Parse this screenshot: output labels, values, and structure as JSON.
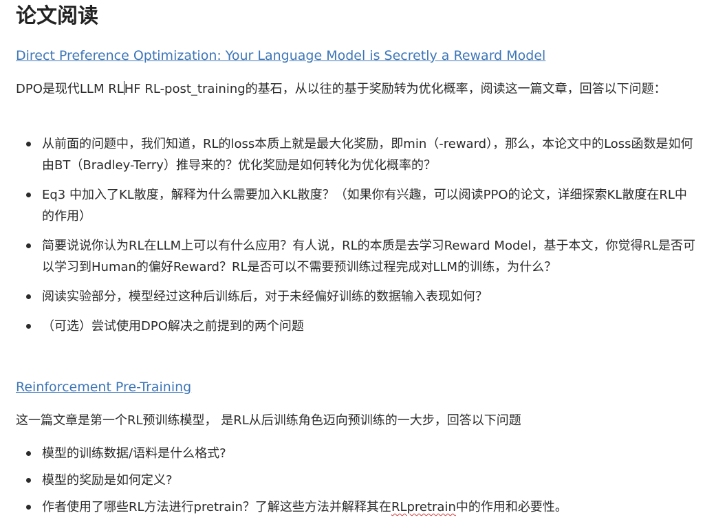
{
  "title": "论文阅读",
  "section1": {
    "link_text": "Direct Preference Optimization: Your Language Model is Secretly a Reward Model",
    "intro_part1": "DPO是现代LLM RL",
    "intro_part2": "HF RL-post_training的基石，从以往的基于奖励转为优化概率，阅读这一篇文章，回答以下问题：",
    "questions": [
      "从前面的问题中，我们知道，RL的loss本质上就是最大化奖励，即min（-reward），那么，本论文中的Loss函数是如何由BT（Bradley-Terry）推导来的？优化奖励是如何转化为优化概率的？",
      "Eq3 中加入了KL散度，解释为什么需要加入KL散度？（如果你有兴趣，可以阅读PPO的论文，详细探索KL散度在RL中的作用）",
      "简要说说你认为RL在LLM上可以有什么应用？有人说，RL的本质是去学习Reward Model，基于本文，你觉得RL是否可以学习到Human的偏好Reward？RL是否可以不需要预训练过程完成对LLM的训练，为什么？",
      "阅读实验部分，模型经过这种后训练后，对于未经偏好训练的数据输入表现如何？",
      "（可选）尝试使用DPO解决之前提到的两个问题"
    ]
  },
  "section2": {
    "link_text": "Reinforcement Pre-Training",
    "intro": "这一篇文章是第一个RL预训练模型， 是RL从后训练角色迈向预训练的一大步，回答以下问题",
    "questions": [
      "模型的训练数据/语料是什么格式?",
      "模型的奖励是如何定义?"
    ],
    "last_question_pre": "作者使用了哪些RL方法进行pretrain？了解这些方法并解释其在",
    "last_question_flagged": "RLpretrain",
    "last_question_post": "中的作用和必要性。"
  },
  "colors": {
    "link": "#3d76b8",
    "text": "#2b2b2b",
    "spellcheck": "#d23a3a"
  }
}
